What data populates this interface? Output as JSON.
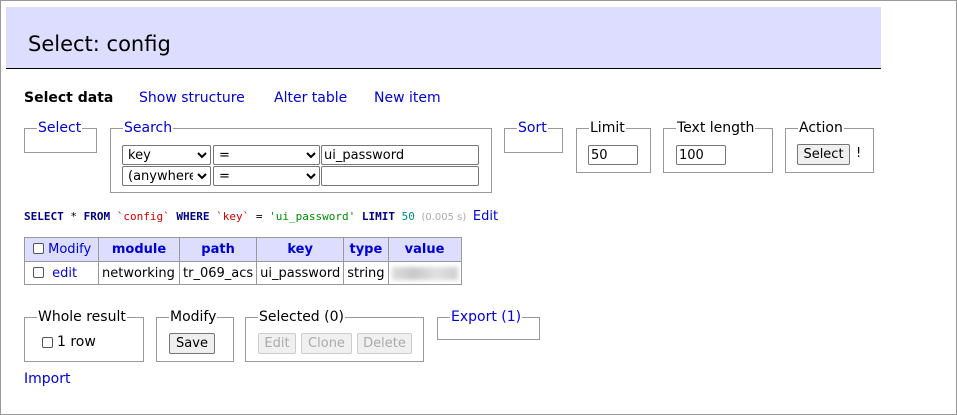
{
  "title": "Select: config",
  "tabs": {
    "select_data": "Select data",
    "show_structure": "Show structure",
    "alter_table": "Alter table",
    "new_item": "New item"
  },
  "fieldsets": {
    "select": "Select",
    "search": "Search",
    "sort": "Sort",
    "limit": "Limit",
    "text_length": "Text length",
    "action": "Action"
  },
  "search": {
    "row1": {
      "column": "key",
      "operator": "=",
      "value": "ui_password"
    },
    "row2": {
      "column": "(anywhere)",
      "operator": "=",
      "value": ""
    }
  },
  "limit_value": "50",
  "text_length_value": "100",
  "action": {
    "select_button": "Select",
    "warning": "!"
  },
  "query": {
    "select": "SELECT",
    "star": "*",
    "from": "FROM",
    "table": "`config`",
    "where": "WHERE",
    "column": "`key`",
    "eq": "=",
    "value": "'ui_password'",
    "limit": "LIMIT",
    "limit_value": "50",
    "time": "(0.005 s)",
    "edit_link": "Edit"
  },
  "table": {
    "headers": [
      "Modify",
      "module",
      "path",
      "key",
      "type",
      "value"
    ],
    "rows": [
      {
        "action": "edit",
        "module": "networking",
        "path": "tr_069_acs",
        "key": "ui_password",
        "type": "string",
        "value": ""
      }
    ]
  },
  "bottom": {
    "whole_result": "Whole result",
    "one_row": "1 row",
    "modify": "Modify",
    "save": "Save",
    "selected": "Selected (0)",
    "edit": "Edit",
    "clone": "Clone",
    "delete": "Delete",
    "export": "Export (1)",
    "import": "Import"
  }
}
